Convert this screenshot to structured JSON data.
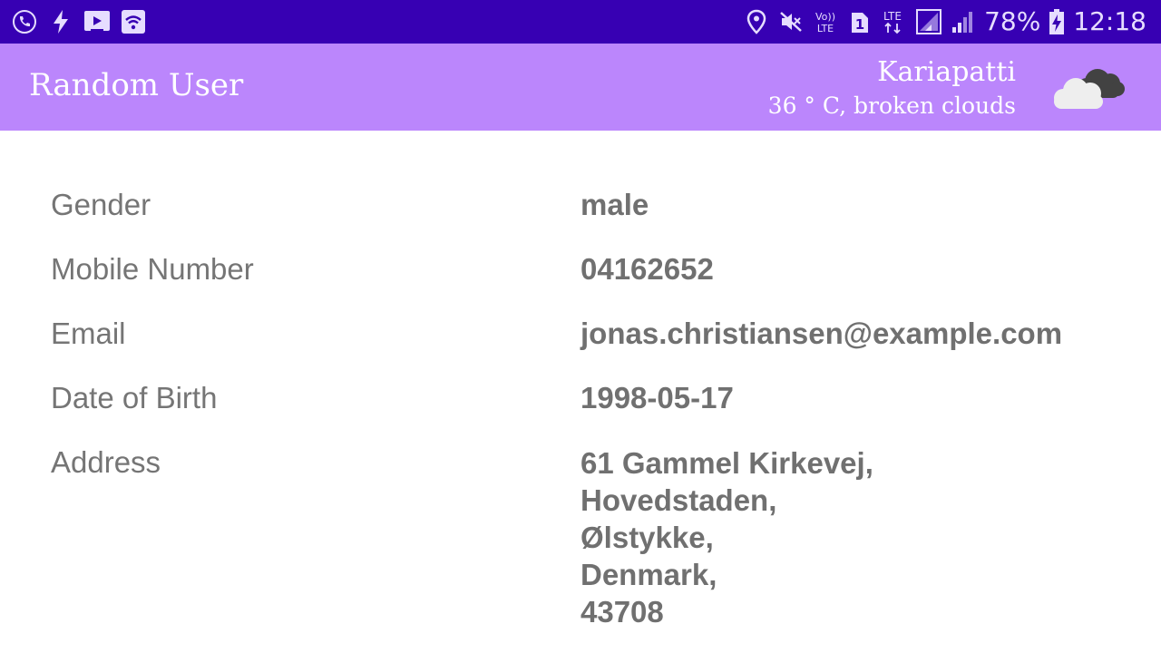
{
  "status_bar": {
    "left_icons": [
      "call-recording-icon",
      "flash-icon",
      "cast-screen-icon",
      "wifi-hotspot-icon"
    ],
    "right_icons": [
      "location-icon",
      "mute-icon",
      "volte-icon",
      "sim-one-icon",
      "lte-signal-icon",
      "cellular-signal-icon",
      "battery-charging-icon"
    ],
    "volte_label": "Vo)) LTE",
    "sim_label": "1",
    "lte_label": "LTE",
    "battery_percent": "78%",
    "time": "12:18"
  },
  "app_bar": {
    "title": "Random User",
    "weather": {
      "city": "Kariapatti",
      "condition": "36 ° C, broken clouds",
      "icon": "broken-clouds-icon"
    },
    "colors": {
      "status_bar": "#3700b3",
      "app_bar": "#bb86fc"
    }
  },
  "details": {
    "gender": {
      "label": "Gender",
      "value": "male"
    },
    "mobile": {
      "label": "Mobile Number",
      "value": "04162652"
    },
    "email": {
      "label": "Email",
      "value": "jonas.christiansen@example.com"
    },
    "dob": {
      "label": "Date of Birth",
      "value": "1998-05-17"
    },
    "address": {
      "label": "Address",
      "lines": [
        "61 Gammel Kirkevej,",
        "Hovedstaden,",
        "Ølstykke,",
        "Denmark,",
        "43708"
      ]
    }
  }
}
